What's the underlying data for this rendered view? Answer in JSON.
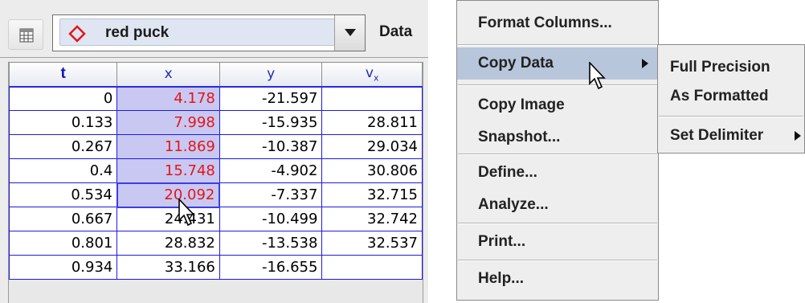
{
  "toolbar": {
    "track_name": "red puck",
    "data_label": "Data",
    "track_color": "#e31616"
  },
  "table": {
    "headers": {
      "t": "t",
      "x": "x",
      "y": "y",
      "v": "v",
      "v_sub": "x"
    },
    "rows": [
      {
        "t": "0",
        "x": "4.178",
        "y": "-21.597",
        "vx": ""
      },
      {
        "t": "0.133",
        "x": "7.998",
        "y": "-15.935",
        "vx": "28.811"
      },
      {
        "t": "0.267",
        "x": "11.869",
        "y": "-10.387",
        "vx": "29.034"
      },
      {
        "t": "0.4",
        "x": "15.748",
        "y": "-4.902",
        "vx": "30.806"
      },
      {
        "t": "0.534",
        "x": "20.092",
        "y": "-7.337",
        "vx": "32.715"
      },
      {
        "t": "0.667",
        "x": "24.431",
        "y": "-10.499",
        "vx": "32.742"
      },
      {
        "t": "0.801",
        "x": "28.832",
        "y": "-13.538",
        "vx": "32.537"
      },
      {
        "t": "0.934",
        "x": "33.166",
        "y": "-16.655",
        "vx": ""
      }
    ],
    "selected_x_rows": 5,
    "selection_color": "#c9c8f2",
    "selected_text_color": "#e31616"
  },
  "menu": {
    "items": [
      {
        "label": "Format Columns..."
      },
      {
        "label": "Copy Data"
      },
      {
        "label": "Copy Image"
      },
      {
        "label": "Snapshot..."
      },
      {
        "label": "Define..."
      },
      {
        "label": "Analyze..."
      },
      {
        "label": "Print..."
      },
      {
        "label": "Help..."
      }
    ],
    "active_item": "Copy Data",
    "active_color": "#b8c6dc"
  },
  "submenu": {
    "items": [
      {
        "label": "Full Precision"
      },
      {
        "label": "As Formatted"
      },
      {
        "label": "Set Delimiter"
      }
    ]
  }
}
